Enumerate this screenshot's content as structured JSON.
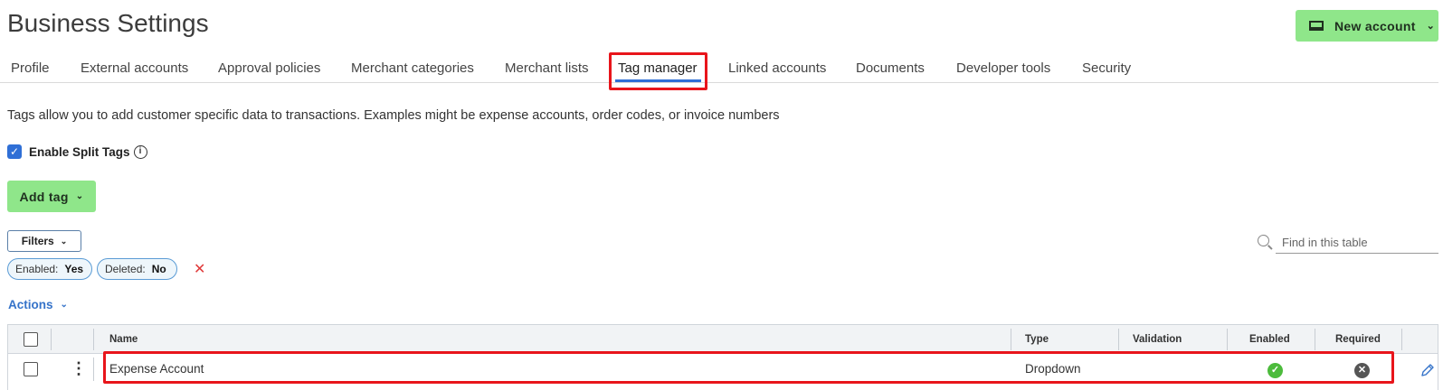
{
  "page": {
    "title": "Business Settings"
  },
  "header": {
    "new_account_label": "New account",
    "new_account_icon": "card-icon"
  },
  "tabs": [
    {
      "label": "Profile"
    },
    {
      "label": "External accounts"
    },
    {
      "label": "Approval policies"
    },
    {
      "label": "Merchant categories"
    },
    {
      "label": "Merchant lists"
    },
    {
      "label": "Tag manager",
      "active": true
    },
    {
      "label": "Linked accounts"
    },
    {
      "label": "Documents"
    },
    {
      "label": "Developer tools"
    },
    {
      "label": "Security"
    }
  ],
  "description": "Tags allow you to add customer specific data to transactions. Examples might be expense accounts, order codes, or invoice numbers",
  "split_tags": {
    "label": "Enable Split Tags",
    "checked": true
  },
  "add_tag": {
    "label": "Add tag"
  },
  "filters": {
    "label": "Filters",
    "chips": [
      {
        "name": "Enabled:",
        "value": "Yes"
      },
      {
        "name": "Deleted:",
        "value": "No"
      }
    ]
  },
  "search": {
    "placeholder": "Find in this table"
  },
  "actions": {
    "label": "Actions"
  },
  "table": {
    "columns": [
      "Name",
      "Type",
      "Validation",
      "Enabled",
      "Required"
    ],
    "rows": [
      {
        "name": "Expense Account",
        "type": "Dropdown",
        "validation": "",
        "enabled": true,
        "required": false
      }
    ]
  },
  "colors": {
    "accent_green": "#8fe68a",
    "link_blue": "#3573c9",
    "tab_underline": "#2f6fd6",
    "highlight_red": "#e8151b",
    "enabled_green": "#4cbb3c"
  }
}
